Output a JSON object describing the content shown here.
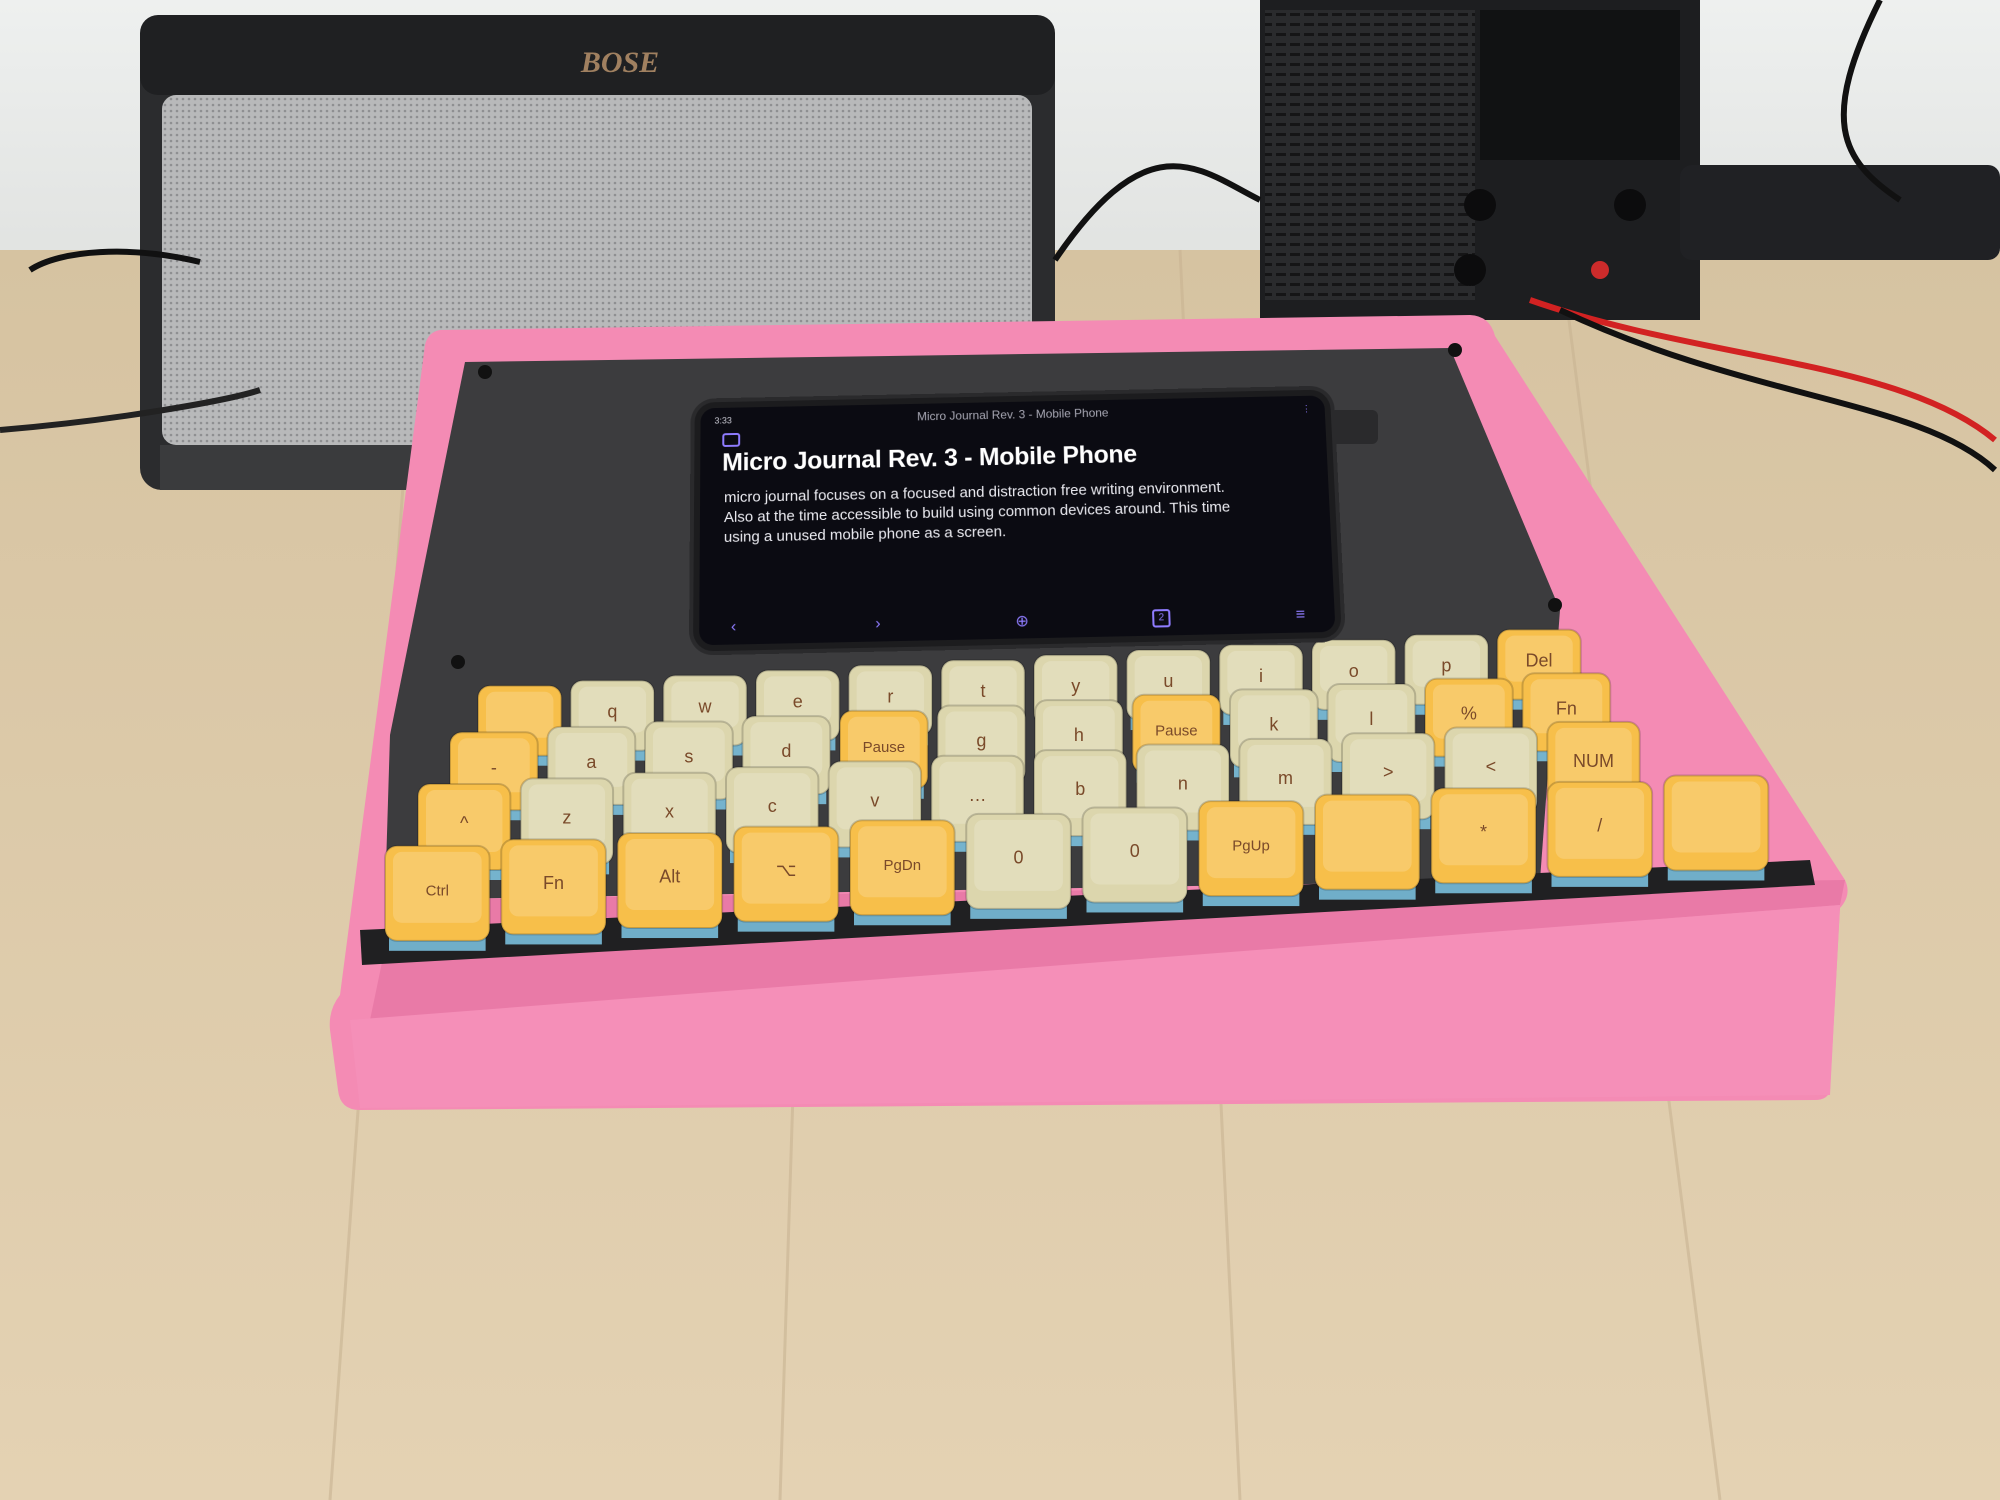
{
  "speaker": {
    "brand": "BOSE"
  },
  "phone": {
    "status_time": "3:33",
    "app_title": "Micro Journal Rev. 3 - Mobile Phone",
    "document_title": "Micro Journal Rev. 3 - Mobile Phone",
    "document_body": "micro journal focuses on a focused and distraction free writing environment. Also at the time accessible to build using common devices around. This time using a unused mobile phone as a screen.",
    "bottom_bar": {
      "back": "‹",
      "forward": "›",
      "add": "⊕",
      "tabs": "2",
      "menu": "≡"
    }
  },
  "keyboard": {
    "case_color": "#f48bb4",
    "plate_color": "#2f2f31",
    "key_yellow": "#f7bf4a",
    "key_beige": "#dcd6ad",
    "legend_color": "#7a4a2a",
    "rows": [
      [
        "",
        "q",
        "w",
        "e",
        "r",
        "t",
        "y",
        "u",
        "i",
        "o",
        "p",
        "Del"
      ],
      [
        "-",
        "a",
        "s",
        "d",
        "Pause",
        "g",
        "h",
        "Pause",
        "k",
        "l",
        "%",
        "Fn"
      ],
      [
        "^",
        "z",
        "x",
        "c",
        "v",
        "…",
        "b",
        "n",
        "m",
        ">",
        "<",
        "NUM"
      ],
      [
        "Ctrl",
        "Fn",
        "Alt",
        "⌥",
        "PgDn",
        "0",
        "0",
        "PgUp",
        "",
        "*",
        "/",
        ""
      ]
    ],
    "row_colors": [
      [
        "y",
        "b",
        "b",
        "b",
        "b",
        "b",
        "b",
        "b",
        "b",
        "b",
        "b",
        "y"
      ],
      [
        "y",
        "b",
        "b",
        "b",
        "y",
        "b",
        "b",
        "y",
        "b",
        "b",
        "y",
        "y"
      ],
      [
        "y",
        "b",
        "b",
        "b",
        "b",
        "b",
        "b",
        "b",
        "b",
        "b",
        "b",
        "y"
      ],
      [
        "y",
        "y",
        "y",
        "y",
        "y",
        "b",
        "b",
        "y",
        "y",
        "y",
        "y",
        "y"
      ]
    ]
  }
}
